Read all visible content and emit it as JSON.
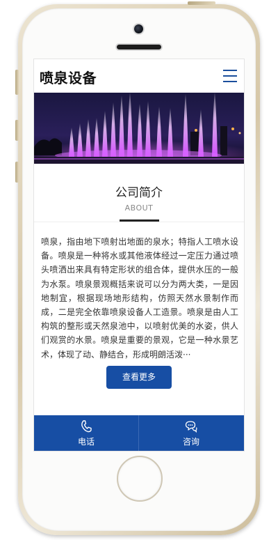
{
  "header": {
    "logo_text": "喷泉设备",
    "menu_icon": "hamburger-menu-icon"
  },
  "banner": {
    "image": "fountain-light-show-photo"
  },
  "about": {
    "title": "公司简介",
    "subtitle": "ABOUT",
    "text": "喷泉，指由地下喷射出地面的泉水；特指人工喷水设备。喷泉是一种将水或其他液体经过一定压力通过喷头喷洒出来具有特定形状的组合体，提供水压的一般为水泵。喷泉景观概括来说可以分为两大类，一是因地制宜，根据现场地形结构，仿照天然水景制作而成，二是完全依靠喷泉设备人工造景。喷泉是由人工构筑的整形或天然泉池中，以喷射优美的水姿，供人们观赏的水景。喷泉是重要的景观，它是一种水景艺术，体现了动、静结合，形成明朗活泼···",
    "more_label": "查看更多"
  },
  "bottom_nav": {
    "items": [
      {
        "label": "电话",
        "icon": "phone-icon"
      },
      {
        "label": "咨询",
        "icon": "chat-icon"
      }
    ]
  },
  "colors": {
    "primary": "#174ea4",
    "menu_icon": "#1a4e9c",
    "text": "#333333"
  }
}
